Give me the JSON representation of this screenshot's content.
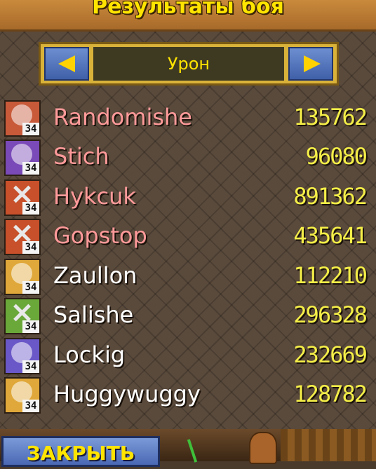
{
  "window": {
    "title": "Результаты боя"
  },
  "selector": {
    "label": "Урон"
  },
  "players": [
    {
      "name": "Randomishe",
      "score": "135762",
      "level": "34",
      "name_color": "#ff9a9a",
      "icon": "dino-skull-icon",
      "avatar_color": "#c85a3a"
    },
    {
      "name": "Stich",
      "score": "96080",
      "level": "34",
      "name_color": "#ff9a9a",
      "icon": "helmet-icon",
      "avatar_color": "#7a4ab8"
    },
    {
      "name": "Hykcuk",
      "score": "891362",
      "level": "34",
      "name_color": "#ff9a9a",
      "icon": "crossed-axes-icon",
      "avatar_color": "#c8502a"
    },
    {
      "name": "Gopstop",
      "score": "435641",
      "level": "34",
      "name_color": "#ff9a9a",
      "icon": "crossed-axes-icon",
      "avatar_color": "#c8502a"
    },
    {
      "name": "Zaullon",
      "score": "112210",
      "level": "34",
      "name_color": "#ffffff",
      "icon": "shield-icon",
      "avatar_color": "#e0a83a"
    },
    {
      "name": "Salishe",
      "score": "296328",
      "level": "34",
      "name_color": "#ffffff",
      "icon": "crossed-swords-icon",
      "avatar_color": "#6aa83a"
    },
    {
      "name": "Lockig",
      "score": "232669",
      "level": "34",
      "name_color": "#ffffff",
      "icon": "wizard-hat-icon",
      "avatar_color": "#6a58c8"
    },
    {
      "name": "Huggywuggy",
      "score": "128782",
      "level": "34",
      "name_color": "#ffffff",
      "icon": "shield-icon",
      "avatar_color": "#e0a83a"
    }
  ],
  "footer": {
    "close_label": "ЗАКРЫТЬ"
  }
}
